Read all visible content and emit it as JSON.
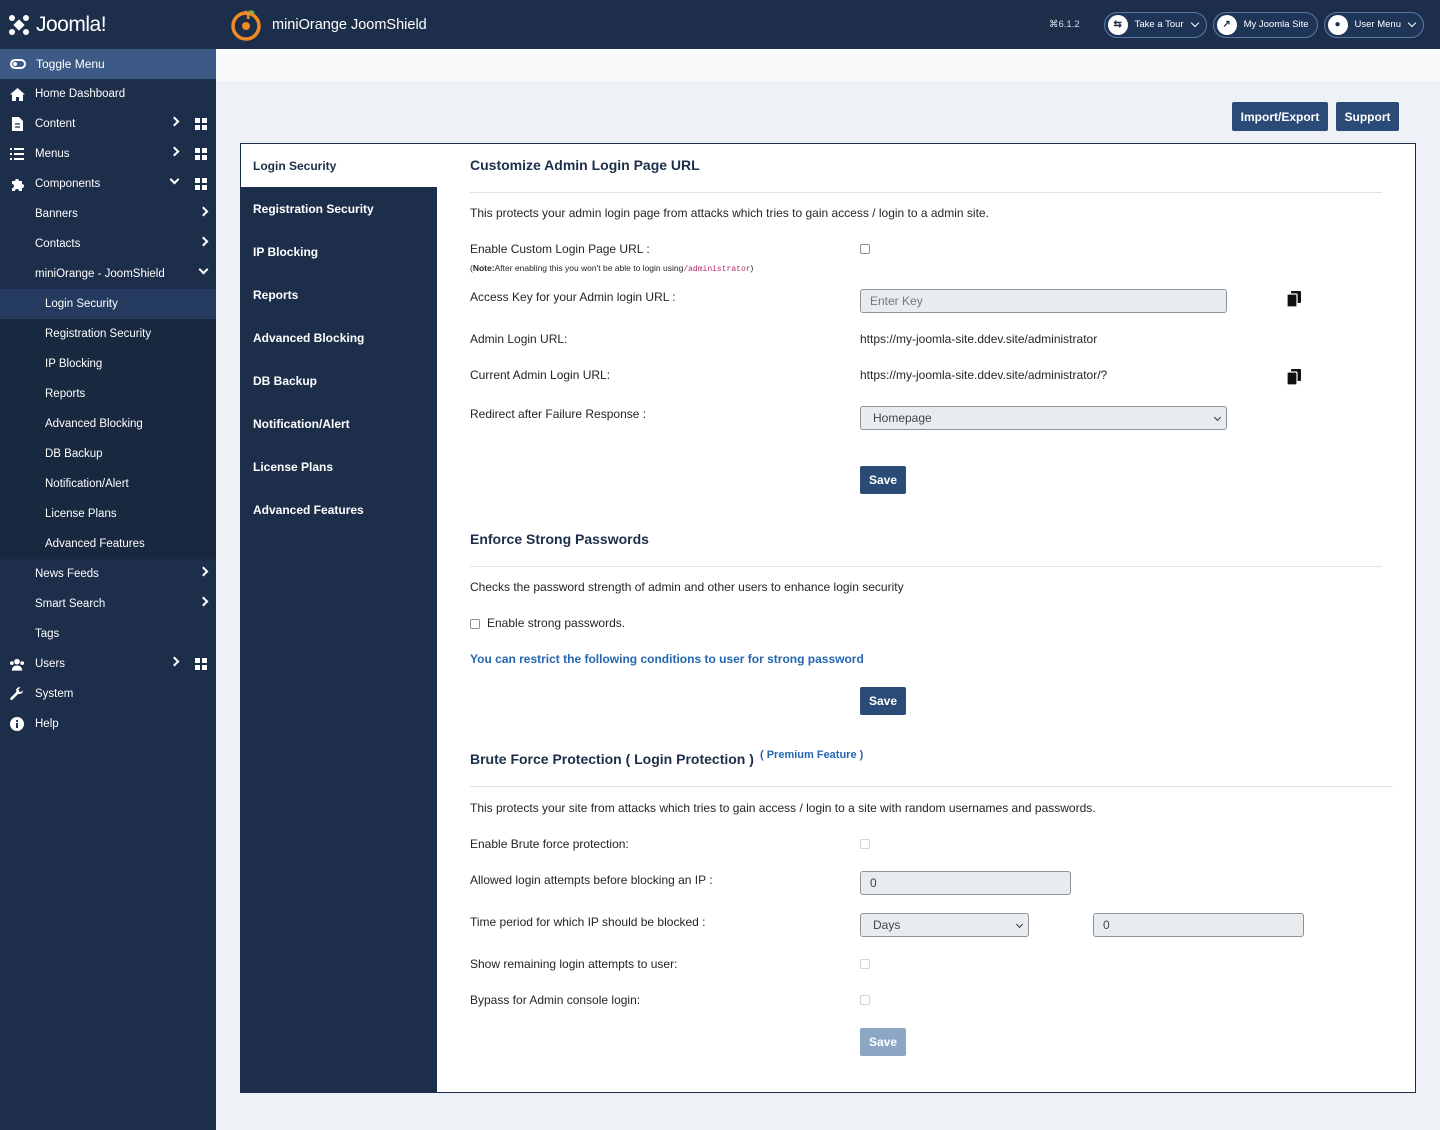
{
  "brand": {
    "name": "Joomla!"
  },
  "sidebar": {
    "toggle_label": "Toggle Menu",
    "items": [
      {
        "label": "Home Dashboard",
        "icon": "home-icon"
      },
      {
        "label": "Content",
        "icon": "file-icon"
      },
      {
        "label": "Menus",
        "icon": "list-icon"
      },
      {
        "label": "Components",
        "icon": "puzzle-icon"
      }
    ],
    "components": [
      "Banners",
      "Contacts",
      "miniOrange - JoomShield"
    ],
    "joomshield": [
      "Login Security",
      "Registration Security",
      "IP Blocking",
      "Reports",
      "Advanced Blocking",
      "DB Backup",
      "Notification/Alert",
      "License Plans",
      "Advanced Features"
    ],
    "components_more": [
      "News Feeds",
      "Smart Search",
      "Tags"
    ],
    "bottom": [
      {
        "label": "Users",
        "icon": "users-icon"
      },
      {
        "label": "System",
        "icon": "wrench-icon"
      },
      {
        "label": "Help",
        "icon": "info-icon"
      }
    ]
  },
  "header": {
    "title": "miniOrange JoomShield",
    "version": "⌘6.1.2",
    "take_tour": "Take a Tour",
    "my_site": "My Joomla Site",
    "user_menu": "User Menu"
  },
  "toolbar": {
    "import_export": "Import/Export",
    "support": "Support"
  },
  "tabs": [
    "Login Security",
    "Registration Security",
    "IP Blocking",
    "Reports",
    "Advanced Blocking",
    "DB Backup",
    "Notification/Alert",
    "License Plans",
    "Advanced Features"
  ],
  "section1": {
    "title": "Customize Admin Login Page URL",
    "desc": "This protects your admin login page from attacks which tries to gain access / login to a admin site.",
    "enable_label": "Enable Custom Login Page URL :",
    "note_bold": "Note:",
    "note_text": "After enabling this you won't be able to login using",
    "note_code": "/administrator",
    "note_end": ")",
    "note_start": "(",
    "access_key_label": "Access Key for your Admin login URL :",
    "access_key_placeholder": "Enter Key",
    "admin_url_label": "Admin Login URL:",
    "admin_url": "https://my-joomla-site.ddev.site/administrator",
    "current_url_label": "Current Admin Login URL:",
    "current_url": "https://my-joomla-site.ddev.site/administrator/?",
    "redirect_label": "Redirect after Failure Response :",
    "redirect_value": "Homepage",
    "save": "Save"
  },
  "section2": {
    "title": "Enforce Strong Passwords",
    "desc": "Checks the password strength of admin and other users to enhance login security",
    "enable_label": "Enable strong passwords.",
    "link": "You can restrict the following conditions to user for strong password",
    "save": "Save"
  },
  "section3": {
    "title": "Brute Force Protection ( Login Protection )",
    "premium": "( Premium Feature )",
    "desc": "This protects your site from attacks which tries to gain access / login to a site with random usernames and passwords.",
    "enable_label": "Enable Brute force protection:",
    "attempts_label": "Allowed login attempts before blocking an IP :",
    "attempts_value": "0",
    "period_label": "Time period for which IP should be blocked :",
    "period_unit": "Days",
    "period_value": "0",
    "remaining_label": "Show remaining login attempts to user:",
    "bypass_label": "Bypass for Admin console login:",
    "save": "Save"
  }
}
